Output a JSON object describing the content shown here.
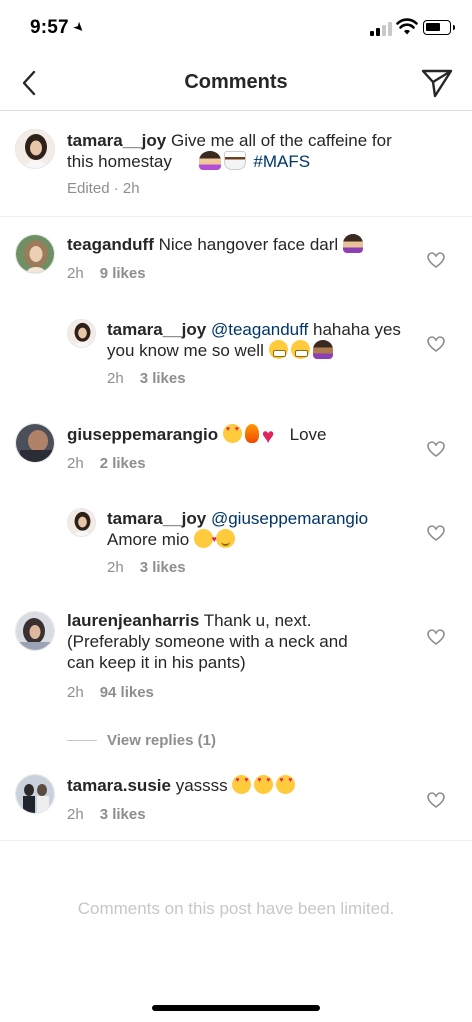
{
  "status_bar": {
    "time": "9:57"
  },
  "nav": {
    "title": "Comments"
  },
  "caption": {
    "username": "tamara__joy",
    "text": "Give me all of the caffeine for this homestay",
    "emojis": [
      "shrug-emoji",
      "coffee-emoji"
    ],
    "hashtag": "#MAFS",
    "meta": "Edited · 2h"
  },
  "comments": [
    {
      "username": "teaganduff",
      "text": "Nice hangover face darl",
      "emojis": [
        "person-facepalming-emoji"
      ],
      "time": "2h",
      "likes": "9 likes"
    },
    {
      "username": "tamara__joy",
      "mention": "@teaganduff",
      "text": "hahaha yes you know me so well",
      "emojis": [
        "grimacing-emoji",
        "grimacing-emoji",
        "person-facepalming-emoji"
      ],
      "time": "2h",
      "likes": "3 likes",
      "is_reply": true
    },
    {
      "username": "giuseppemarangio",
      "text": "Love",
      "emojis": [
        "heart-eyes-emoji",
        "fire-emoji",
        "red-heart-emoji"
      ],
      "time": "2h",
      "likes": "2 likes"
    },
    {
      "username": "tamara__joy",
      "mention": "@giuseppemarangio",
      "text": "Amore mio",
      "emojis": [
        "kissing-heart-emoji",
        "relieved-emoji"
      ],
      "time": "2h",
      "likes": "3 likes",
      "is_reply": true
    },
    {
      "username": "laurenjeanharris",
      "text_line1": "Thank u, next.",
      "text_line2": "(Preferably someone with a neck and",
      "text_line3": "can keep it in his pants)",
      "time": "2h",
      "likes": "94 likes"
    },
    {
      "username": "tamara.susie",
      "text": "yassss",
      "emojis": [
        "heart-eyes-emoji",
        "heart-eyes-emoji",
        "heart-eyes-emoji"
      ],
      "time": "2h",
      "likes": "3 likes"
    }
  ],
  "view_replies": {
    "label": "View replies (1)"
  },
  "footer": {
    "limited_text": "Comments on this post have been limited."
  },
  "colors": {
    "text": "#262626",
    "secondary": "#8e8e8e",
    "link": "#003569",
    "divider": "#efefef"
  }
}
